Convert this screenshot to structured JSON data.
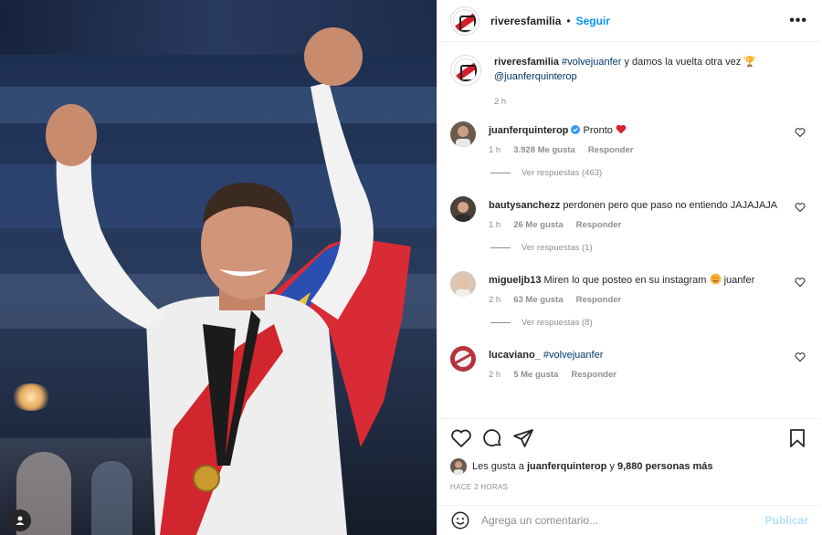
{
  "post": {
    "username": "riveresfamilia",
    "separator": "•",
    "follow_label": "Seguir",
    "more_label": "•••",
    "caption": {
      "username": "riveresfamilia",
      "hashtag": "#volvejuanfer",
      "text": " y damos la vuelta otra vez 🏆",
      "mention": "@juanferquinterop",
      "time": "2 h"
    },
    "comments": [
      {
        "username": "juanferquinterop",
        "verified": true,
        "text": "Pronto",
        "time": "1 h",
        "likes": "3.928 Me gusta",
        "reply_label": "Responder",
        "view_replies": "Ver respuestas (463)",
        "avatar_color": "#6b5a4e"
      },
      {
        "username": "bautysanchezz",
        "text": "perdonen pero que paso no entiendo JAJAJAJA",
        "time": "1 h",
        "likes": "26 Me gusta",
        "reply_label": "Responder",
        "view_replies": "Ver respuestas (1)",
        "avatar_color": "#4a4238"
      },
      {
        "username": "migueljb13",
        "text": "Miren lo que posteo en su instagram",
        "text_after": "juanfer",
        "time": "2 h",
        "likes": "63 Me gusta",
        "reply_label": "Responder",
        "view_replies": "Ver respuestas (8)",
        "avatar_color": "#d9c7b8"
      },
      {
        "username": "lucaviano_",
        "hashtag": "#volvejuanfer",
        "time": "2 h",
        "likes": "5 Me gusta",
        "reply_label": "Responder",
        "avatar_color": "#b5343c"
      }
    ],
    "likes_prefix": "Les gusta a",
    "likes_user": "juanferquinterop",
    "likes_joiner": "y",
    "likes_count": "9,880 personas más",
    "posted_ago": "HACE 2 HORAS",
    "comment_placeholder": "Agrega un comentario...",
    "publish_label": "Publicar"
  },
  "colors": {
    "accent_blue": "#0095f6",
    "publish_disabled": "#b2dffc",
    "heart_red": "#ed4956",
    "river_red": "#d61c2a"
  },
  "icons": {
    "like": "heart-outline-icon",
    "comment": "comment-bubble-icon",
    "share": "paper-plane-icon",
    "save": "bookmark-icon",
    "emoji": "smiley-icon",
    "more": "ellipsis-icon",
    "user_tag": "person-icon"
  }
}
